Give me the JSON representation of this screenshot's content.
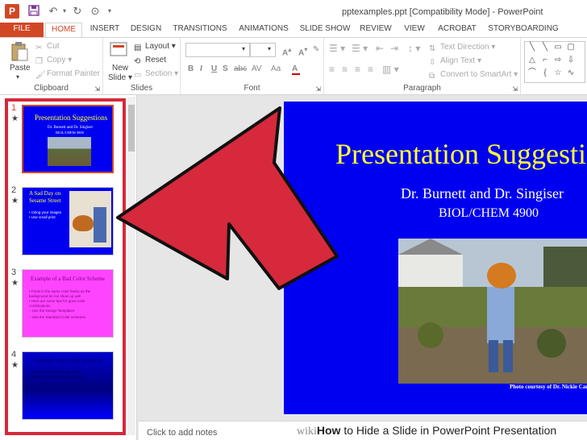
{
  "window": {
    "title": "pptexamples.ppt [Compatibility Mode] - PowerPoint",
    "app_icon": "P"
  },
  "ribbon_tabs": [
    "FILE",
    "HOME",
    "INSERT",
    "DESIGN",
    "TRANSITIONS",
    "ANIMATIONS",
    "SLIDE SHOW",
    "REVIEW",
    "VIEW",
    "ACROBAT",
    "STORYBOARDING"
  ],
  "ribbon": {
    "clipboard": {
      "label": "Clipboard",
      "paste": "Paste",
      "cut": "Cut",
      "copy": "Copy",
      "format_painter": "Format Painter"
    },
    "slides": {
      "label": "Slides",
      "new_slide_line1": "New",
      "new_slide_line2": "Slide",
      "layout": "Layout",
      "reset": "Reset",
      "section": "Section"
    },
    "font": {
      "label": "Font",
      "bold": "B",
      "italic": "I",
      "underline": "U",
      "strike": "S",
      "shadow": "abc",
      "spacing": "AV",
      "case": "Aa"
    },
    "paragraph": {
      "label": "Paragraph",
      "text_direction": "Text Direction",
      "align_text": "Align Text",
      "convert_smartart": "Convert to SmartArt"
    }
  },
  "thumbnails": [
    {
      "number": "1",
      "star": "★",
      "title": "Presentation Suggestions",
      "line1": "Dr. Burnett and Dr. Singiser",
      "line2": "BIOL/CHEM 4900"
    },
    {
      "number": "2",
      "star": "★",
      "title_line1": "A Sad Day on",
      "title_line2": "Sesame Street",
      "bullet1": "• Citing your images",
      "bullet2": "• Use small print"
    },
    {
      "number": "3",
      "star": "★",
      "title": "Example of a Bad Color Scheme",
      "bullets": [
        "• Fonts in the same color family as the",
        "  background do not show up well",
        "• Here are some tips for good color",
        "  combinations",
        "  – Use the Design Templates",
        "  – Use the Standard Color schemes"
      ]
    },
    {
      "number": "4",
      "star": "★",
      "title": "Another Bad Color Scheme",
      "bullet1": "• Dark text on dark background",
      "bullet2": "• Beware of shaded backgrounds"
    }
  ],
  "slide": {
    "title": "Presentation Suggestions",
    "subtitle1": "Dr. Burnett and Dr. Singiser",
    "subtitle2": "BIOL/CHEM 4900",
    "photo_credit": "Photo courtesy of Dr. Nickie Cantrell"
  },
  "notes": {
    "placeholder": "Click to add notes"
  },
  "watermark": {
    "wiki": "wiki",
    "how": "How",
    "rest": " to Hide a Slide in PowerPoint Presentation"
  },
  "colors": {
    "accent": "#d24726",
    "slide_bg": "#0000f0",
    "slide_title": "#ffff33",
    "thumb3_bg": "#ff44ff",
    "annotation_red": "#d6293c"
  }
}
